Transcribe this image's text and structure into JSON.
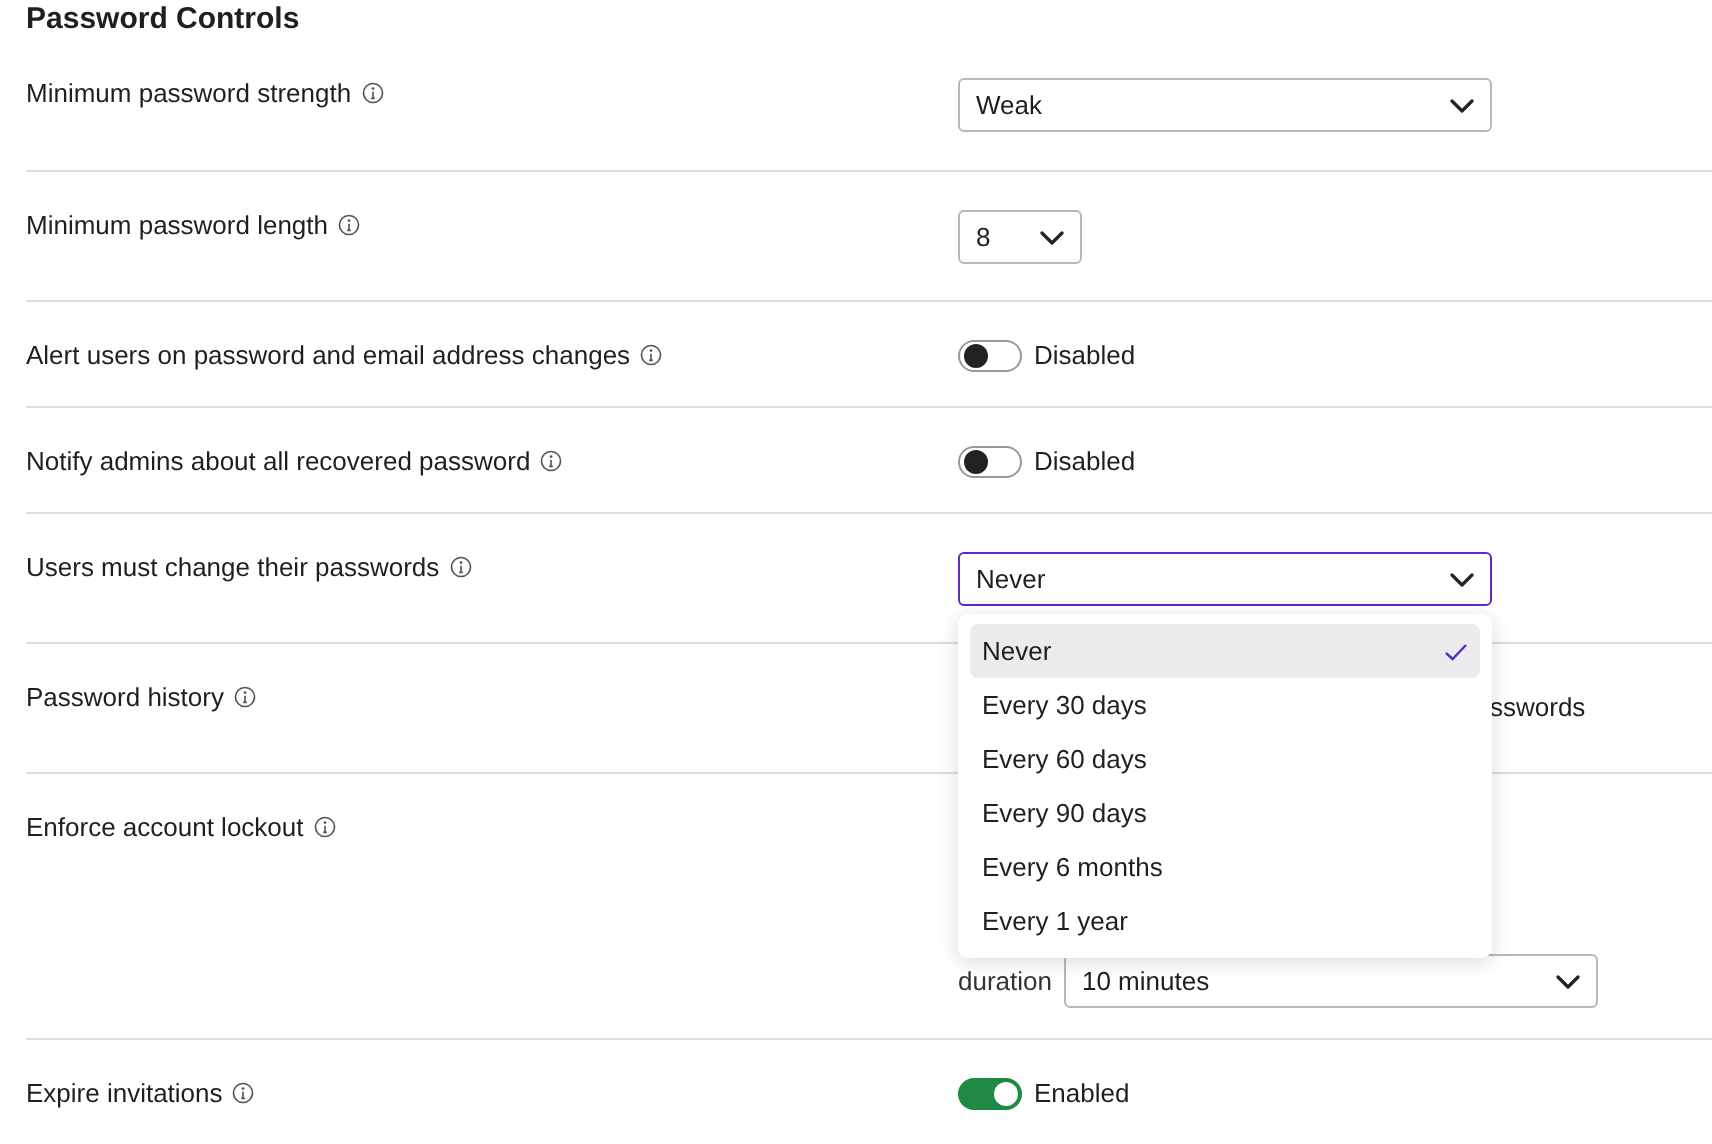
{
  "title": "Password Controls",
  "settings": [
    {
      "kind": "select",
      "label": "Minimum password strength",
      "value": "Weak",
      "focused": false
    },
    {
      "kind": "numberselect",
      "label": "Minimum password length",
      "value": "8",
      "focused": false
    },
    {
      "kind": "toggle",
      "label": "Alert users on password and email address changes",
      "on": false,
      "state_text": "Disabled"
    },
    {
      "kind": "toggle",
      "label": "Notify admins about all recovered password",
      "on": false,
      "state_text": "Disabled"
    },
    {
      "kind": "select",
      "label": "Users must change their passwords",
      "value": "Never",
      "focused": true,
      "menu": [
        {
          "label": "Never",
          "selected": true
        },
        {
          "label": "Every 30 days",
          "selected": false
        },
        {
          "label": "Every 60 days",
          "selected": false
        },
        {
          "label": "Every 90 days",
          "selected": false
        },
        {
          "label": "Every 6 months",
          "selected": false
        },
        {
          "label": "Every 1 year",
          "selected": false
        }
      ]
    },
    {
      "kind": "text",
      "label": "Password history",
      "text": "sswords"
    },
    {
      "kind": "lockout",
      "label": "Enforce account lockout",
      "duration_label": "duration",
      "duration_value": "10 minutes"
    },
    {
      "kind": "toggle",
      "label": "Expire invitations",
      "on": true,
      "state_text": "Enabled"
    }
  ]
}
